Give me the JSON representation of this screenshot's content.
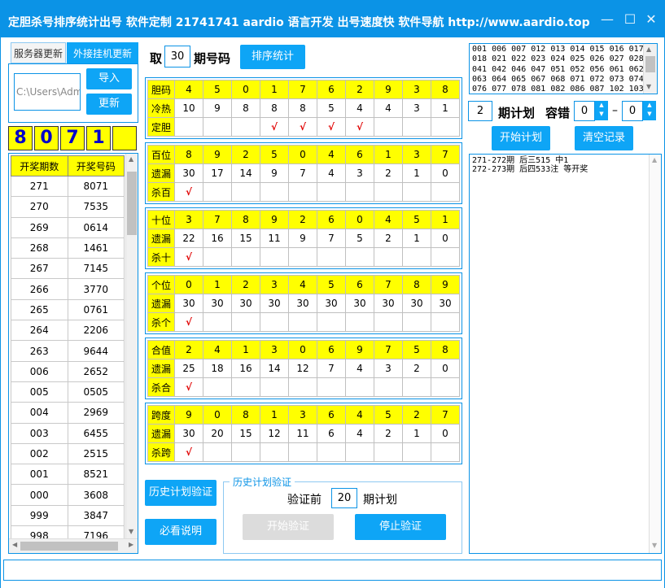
{
  "window": {
    "title": "定胆杀号排序统计出号 软件定制 21741741 aardio 语言开发 出号速度快 软件导航 http://www.aardio.top",
    "min_symbol": "—",
    "max_symbol": "☐",
    "close_symbol": "✕"
  },
  "tabs": {
    "server": "服务器更新",
    "plugin": "外接挂机更新"
  },
  "update": {
    "path": "C:\\Users\\Adm",
    "import_label": "导入",
    "update_label": "更新"
  },
  "digits": [
    "8",
    "0",
    "7",
    "1",
    ""
  ],
  "history": {
    "headers": [
      "开奖期数",
      "开奖号码"
    ],
    "rows": [
      [
        "271",
        "8071"
      ],
      [
        "270",
        "7535"
      ],
      [
        "269",
        "0614"
      ],
      [
        "268",
        "1461"
      ],
      [
        "267",
        "7145"
      ],
      [
        "266",
        "3770"
      ],
      [
        "265",
        "0761"
      ],
      [
        "264",
        "2206"
      ],
      [
        "263",
        "9644"
      ],
      [
        "006",
        "2652"
      ],
      [
        "005",
        "0505"
      ],
      [
        "004",
        "2969"
      ],
      [
        "003",
        "6455"
      ],
      [
        "002",
        "2515"
      ],
      [
        "001",
        "8521"
      ],
      [
        "000",
        "3608"
      ],
      [
        "999",
        "3847"
      ],
      [
        "998",
        "7196"
      ]
    ]
  },
  "top": {
    "take_label": "取",
    "take_value": "30",
    "period_label": "期号码",
    "sort_button": "排序统计"
  },
  "sections": [
    {
      "rows": [
        {
          "label": "胆码",
          "cells": [
            "4",
            "5",
            "0",
            "1",
            "7",
            "6",
            "2",
            "9",
            "3",
            "8"
          ]
        },
        {
          "label": "冷热",
          "cells": [
            "10",
            "9",
            "8",
            "8",
            "8",
            "5",
            "4",
            "4",
            "3",
            "1"
          ]
        },
        {
          "label": "定胆",
          "cells": [
            "",
            "",
            "",
            "√",
            "√",
            "√",
            "√",
            "",
            "",
            ""
          ]
        }
      ]
    },
    {
      "rows": [
        {
          "label": "百位",
          "cells": [
            "8",
            "9",
            "2",
            "5",
            "0",
            "4",
            "6",
            "1",
            "3",
            "7"
          ]
        },
        {
          "label": "遗漏",
          "cells": [
            "30",
            "17",
            "14",
            "9",
            "7",
            "4",
            "3",
            "2",
            "1",
            "0"
          ]
        },
        {
          "label": "杀百",
          "cells": [
            "√",
            "",
            "",
            "",
            "",
            "",
            "",
            "",
            "",
            ""
          ]
        }
      ]
    },
    {
      "rows": [
        {
          "label": "十位",
          "cells": [
            "3",
            "7",
            "8",
            "9",
            "2",
            "6",
            "0",
            "4",
            "5",
            "1"
          ]
        },
        {
          "label": "遗漏",
          "cells": [
            "22",
            "16",
            "15",
            "11",
            "9",
            "7",
            "5",
            "2",
            "1",
            "0"
          ]
        },
        {
          "label": "杀十",
          "cells": [
            "√",
            "",
            "",
            "",
            "",
            "",
            "",
            "",
            "",
            ""
          ]
        }
      ]
    },
    {
      "rows": [
        {
          "label": "个位",
          "cells": [
            "0",
            "1",
            "2",
            "3",
            "4",
            "5",
            "6",
            "7",
            "8",
            "9"
          ]
        },
        {
          "label": "遗漏",
          "cells": [
            "30",
            "30",
            "30",
            "30",
            "30",
            "30",
            "30",
            "30",
            "30",
            "30"
          ]
        },
        {
          "label": "杀个",
          "cells": [
            "√",
            "",
            "",
            "",
            "",
            "",
            "",
            "",
            "",
            ""
          ]
        }
      ]
    },
    {
      "rows": [
        {
          "label": "合值",
          "cells": [
            "2",
            "4",
            "1",
            "3",
            "0",
            "6",
            "9",
            "7",
            "5",
            "8"
          ]
        },
        {
          "label": "遗漏",
          "cells": [
            "25",
            "18",
            "16",
            "14",
            "12",
            "7",
            "4",
            "3",
            "2",
            "0"
          ]
        },
        {
          "label": "杀合",
          "cells": [
            "√",
            "",
            "",
            "",
            "",
            "",
            "",
            "",
            "",
            ""
          ]
        }
      ]
    },
    {
      "rows": [
        {
          "label": "跨度",
          "cells": [
            "9",
            "0",
            "8",
            "1",
            "3",
            "6",
            "4",
            "5",
            "2",
            "7"
          ]
        },
        {
          "label": "遗漏",
          "cells": [
            "30",
            "20",
            "15",
            "12",
            "11",
            "6",
            "4",
            "2",
            "1",
            "0"
          ]
        },
        {
          "label": "杀跨",
          "cells": [
            "√",
            "",
            "",
            "",
            "",
            "",
            "",
            "",
            "",
            ""
          ]
        }
      ]
    }
  ],
  "bottom": {
    "history_verify_button": "历史计划验证",
    "must_read_button": "必看说明",
    "group_title": "历史计划验证",
    "verify_prefix": "验证前",
    "verify_value": "20",
    "verify_suffix": "期计划",
    "start_verify": "开始验证",
    "stop_verify": "停止验证"
  },
  "right": {
    "numbers_text": "001 006 007 012 013 014 015 016 017\n018 021 022 023 024 025 026 027 028\n041 042 046 047 051 052 056 061 062\n063 064 065 067 068 071 072 073 074\n076 077 078 081 082 086 087 102 103",
    "plan_value": "2",
    "plan_label": "期计划",
    "tolerance_label": "容错",
    "tol_min": "0",
    "tol_dash": "–",
    "tol_max": "0",
    "start_plan": "开始计划",
    "clear_records": "清空记录",
    "log_text": "271-272期 后三515 中1\n272-273期 后四533注 等开奖"
  },
  "colors": {
    "accent": "#0b93e6",
    "button": "#0ea5f6",
    "highlight": "#ffff00",
    "check": "#e00000"
  }
}
